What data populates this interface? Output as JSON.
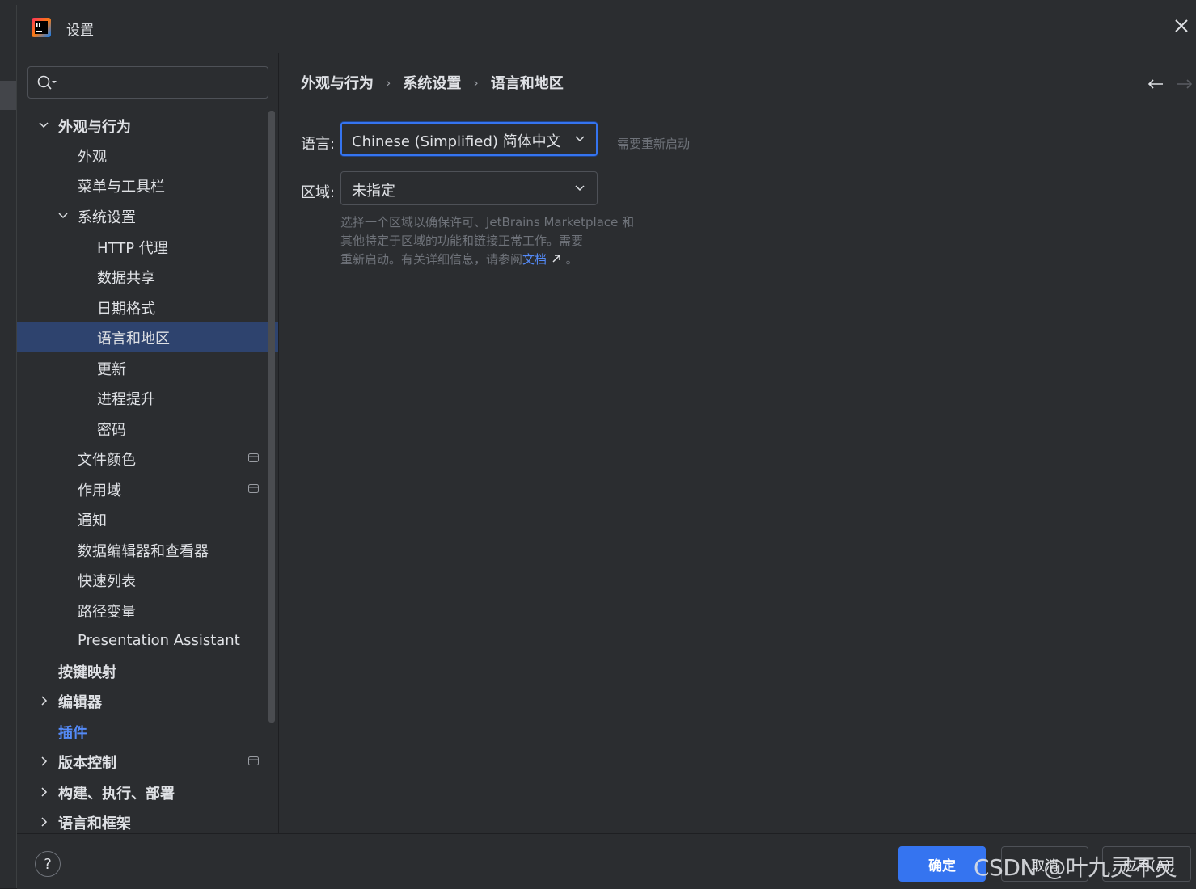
{
  "window": {
    "title": "设置",
    "close_icon": "close-icon"
  },
  "search": {
    "placeholder": "",
    "value": ""
  },
  "sidebar": {
    "items": [
      {
        "label": "外观与行为",
        "bold": true,
        "expanded": true
      },
      {
        "label": "外观"
      },
      {
        "label": "菜单与工具栏"
      },
      {
        "label": "系统设置",
        "expanded": true
      },
      {
        "label": "HTTP 代理"
      },
      {
        "label": "数据共享"
      },
      {
        "label": "日期格式"
      },
      {
        "label": "语言和地区",
        "selected": true
      },
      {
        "label": "更新"
      },
      {
        "label": "进程提升"
      },
      {
        "label": "密码"
      },
      {
        "label": "文件颜色",
        "icon": "project-level-icon"
      },
      {
        "label": "作用域",
        "icon": "project-level-icon"
      },
      {
        "label": "通知"
      },
      {
        "label": "数据编辑器和查看器"
      },
      {
        "label": "快速列表"
      },
      {
        "label": "路径变量"
      },
      {
        "label": "Presentation Assistant"
      },
      {
        "label": "按键映射",
        "bold": true
      },
      {
        "label": "编辑器",
        "bold": true,
        "expanded": false
      },
      {
        "label": "插件",
        "bold": true,
        "color": "#548af7"
      },
      {
        "label": "版本控制",
        "bold": true,
        "expanded": false,
        "icon": "project-level-icon"
      },
      {
        "label": "构建、执行、部署",
        "bold": true,
        "expanded": false
      },
      {
        "label": "语言和框架",
        "bold": true,
        "expanded": false
      }
    ]
  },
  "breadcrumb": [
    "外观与行为",
    "系统设置",
    "语言和地区"
  ],
  "language": {
    "label": "语言:",
    "value": "Chinese (Simplified) 简体中文",
    "note": "需要重新启动"
  },
  "region": {
    "label": "区域:",
    "value": "未指定",
    "help_line1": "选择一个区域以确保许可、JetBrains Marketplace 和",
    "help_line2": "其他特定于区域的功能和链接正常工作。需要",
    "help_line3_prefix": "重新启动。有关详细信息，请参阅",
    "help_link": "文档",
    "help_suffix": " 。"
  },
  "footer": {
    "help": "?",
    "ok": "确定",
    "cancel": "取消",
    "apply": "应用(A)"
  },
  "watermark": "CSDN @叶九灵不灵",
  "colors": {
    "accent": "#3574f0",
    "selection": "#2e436e",
    "link": "#548af7",
    "background": "#2b2d30"
  }
}
